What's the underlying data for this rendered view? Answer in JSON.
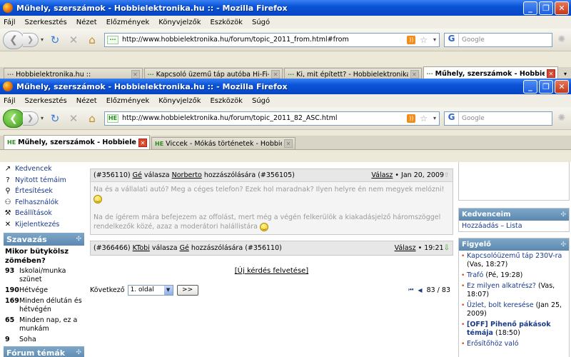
{
  "window_back": {
    "title": "Műhely, szerszámok - Hobbielektronika.hu :: - Mozilla Firefox",
    "url": "http://www.hobbielektronika.hu/forum/topic_2011_from.html#from",
    "tabs": [
      {
        "label": "Hobbielektronika.hu ::",
        "icon": "page-icon"
      },
      {
        "label": "Kapcsoló üzemű táp autóba Hi-Fi-h...",
        "icon": "he-favicon"
      },
      {
        "label": "Ki, mit épített? - Hobbielektronika.h...",
        "icon": "he-favicon"
      },
      {
        "label": "Műhely, szerszámok - Hobbiel...",
        "icon": "he-favicon"
      }
    ]
  },
  "window_front": {
    "title": "Műhely, szerszámok - Hobbielektronika.hu :: - Mozilla Firefox",
    "url": "http://www.hobbielektronika.hu/forum/topic_2011_82_ASC.html",
    "tabs": [
      {
        "label": "Műhely, szerszámok - Hobbielekt...",
        "icon": "he-favicon"
      },
      {
        "label": "Viccek - Mókás történetek - Hobbielekt...",
        "icon": "he-favicon"
      }
    ]
  },
  "menu": [
    "Fájl",
    "Szerkesztés",
    "Nézet",
    "Előzmények",
    "Könyvjelzők",
    "Eszközök",
    "Súgó"
  ],
  "search_placeholder": "Google",
  "favicon_text": "HE",
  "left": {
    "menu_items": [
      {
        "label": "Kedvencek",
        "icon": "bookmark-icon"
      },
      {
        "label": "Nyitott témáim",
        "icon": "question-icon"
      },
      {
        "label": "Értesítések",
        "icon": "magnifier-icon"
      },
      {
        "label": "Felhasználók",
        "icon": "users-icon"
      },
      {
        "label": "Beállítások",
        "icon": "tools-icon"
      },
      {
        "label": "Kijelentkezés",
        "icon": "logout-icon"
      }
    ],
    "poll_title": "Szavazás",
    "poll_question": "Mikor bütykölsz zömében?",
    "poll_rows": [
      {
        "count": "93",
        "label": "Iskolai/munka szünet"
      },
      {
        "count": "190",
        "label": "Hétvége"
      },
      {
        "count": "169",
        "label": "Minden délután és hétvégén"
      },
      {
        "count": "65",
        "label": "Minden nap, ez a munkám"
      },
      {
        "count": "9",
        "label": "Soha"
      }
    ],
    "next_section": "Fórum témák"
  },
  "posts": [
    {
      "id": "(#356110)",
      "author": "Gé",
      "mid": "válasza",
      "reply_to": "Norberto",
      "tail": "hozzászólására",
      "ref": "(#356105)",
      "reply_label": "Válasz",
      "date": "• Jan 20, 2009",
      "para1": "Na és a vállalati autó? Meg a céges telefon? Ezek hol maradnak? Ilyen helyre én nem megyek melózni!",
      "para2": "Na de ígérem mára befejezem az offolást, mert még a végén felkerülök a kiakadásjelző háromszöggel rendelkezők közé, azaz a moderátori halállistára"
    },
    {
      "id": "(#366466)",
      "author": "KTobi",
      "mid": "válasza",
      "reply_to": "Gé",
      "tail": "hozzászólására",
      "ref": "(#356110)",
      "reply_label": "Válasz",
      "date": "• 19:21"
    }
  ],
  "new_question": "[Új kérdés felvetése]",
  "pager": {
    "next_label": "Következő",
    "page_select": "1. oldal",
    "go": ">>",
    "position": "83 / 83"
  },
  "right": {
    "fav_title": "Kedvenceim",
    "fav_links": "Hozzáadás – Lista",
    "watch_title": "Figyelő",
    "items": [
      {
        "link": "Kapcsolóüzemű táp 230V-ra",
        "meta": " (Vas, 18:27)",
        "bold": false
      },
      {
        "link": "Trafó",
        "meta": " (Pé, 19:28)",
        "bold": false
      },
      {
        "link": "Ez milyen alkatrész?",
        "meta": " (Vas, 18:07)",
        "bold": false
      },
      {
        "link": "Üzlet, bolt keresése",
        "meta": " (Jan 25, 2009)",
        "bold": false
      },
      {
        "link": "[OFF] Pihenő pákások témája",
        "meta": " (18:50)",
        "bold": true
      },
      {
        "link": "Erősítőhöz való",
        "meta": "",
        "bold": false
      }
    ]
  }
}
